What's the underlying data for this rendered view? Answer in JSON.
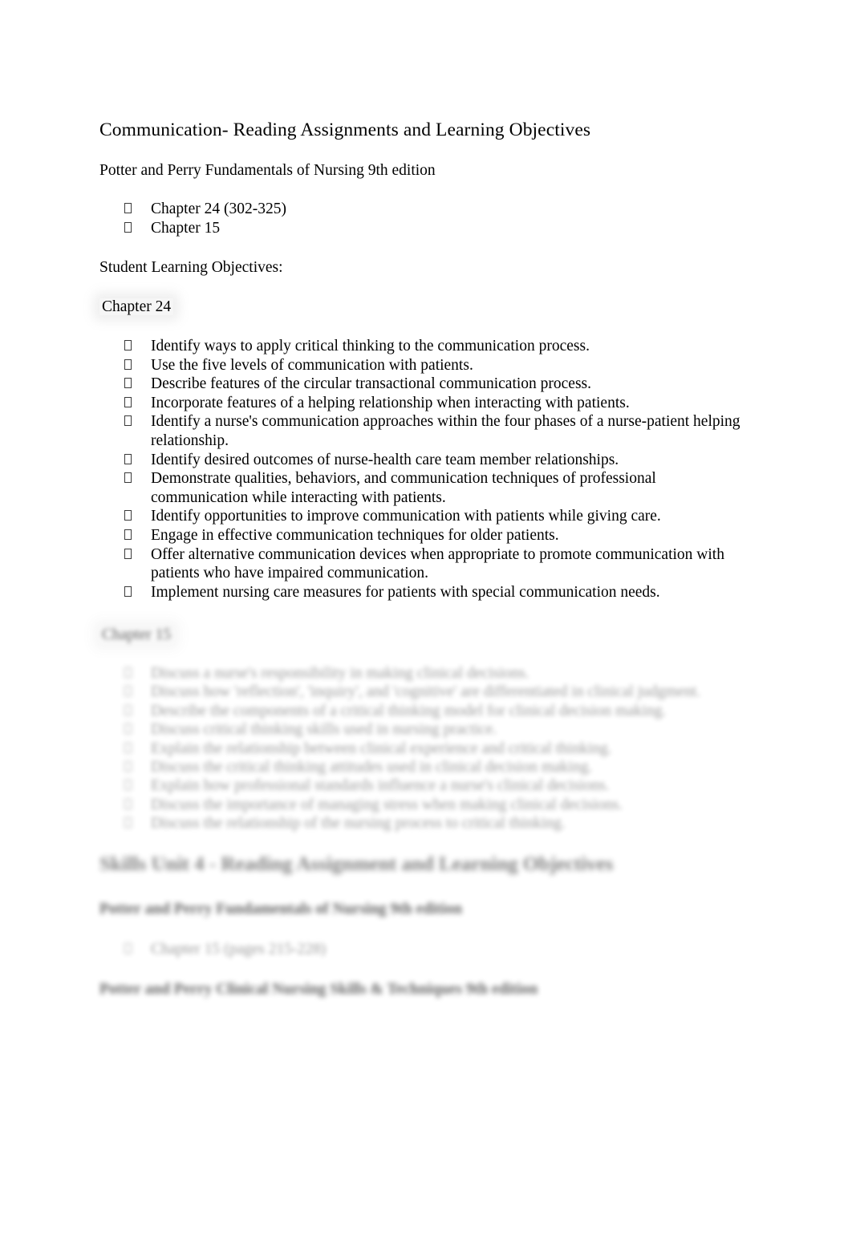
{
  "document": {
    "title": "Communication- Reading Assignments and Learning Objectives",
    "textbook": "Potter and Perry Fundamentals of Nursing 9th edition",
    "reading_bullets": [
      "Chapter 24 (302-325)",
      "Chapter 15"
    ],
    "objectives_label": "Student Learning Objectives:",
    "chapter_24": {
      "heading": "Chapter 24",
      "objectives": [
        "Identify ways to apply critical thinking to the communication process.",
        "Use the five levels of communication with patients.",
        "Describe features of the circular transactional communication process.",
        "Incorporate features of a helping relationship when interacting with patients.",
        "Identify a nurse's communication approaches within the four phases of a nurse-patient helping relationship.",
        "Identify desired outcomes of nurse-health care team member relationships.",
        "Demonstrate qualities, behaviors, and communication techniques of professional communication while interacting with patients.",
        "Identify opportunities to improve communication with patients while giving care.",
        "Engage in effective communication techniques for older patients.",
        "Offer alternative communication devices when appropriate to promote communication with patients who have impaired communication.",
        "Implement nursing care measures for patients with special communication needs."
      ]
    },
    "chapter_15": {
      "heading": "Chapter 15",
      "blurred": true,
      "objectives": [
        "Discuss a nurse's responsibility in making clinical decisions.",
        "Discuss how 'reflection', 'inquiry', and 'cognitive' are differentiated in clinical judgment.",
        "Describe the components of a critical thinking model for clinical decision making.",
        "Discuss critical thinking skills used in nursing practice.",
        "Explain the relationship between clinical experience and critical thinking.",
        "Discuss the critical thinking attitudes used in clinical decision making.",
        "Explain how professional standards influence a nurse's clinical decisions.",
        "Discuss the importance of managing stress when making clinical decisions.",
        "Discuss the relationship of the nursing process to critical thinking."
      ]
    },
    "skills_unit": {
      "blurred": true,
      "heading": "Skills Unit 4 - Reading Assignment and Learning Objectives",
      "textbook_fundamentals": "Potter and Perry Fundamentals of Nursing 9th edition",
      "reading_bullets": [
        "Chapter 15 (pages 215-228)"
      ],
      "textbook_skills": "Potter and Perry Clinical Nursing Skills & Techniques 9th edition"
    }
  }
}
